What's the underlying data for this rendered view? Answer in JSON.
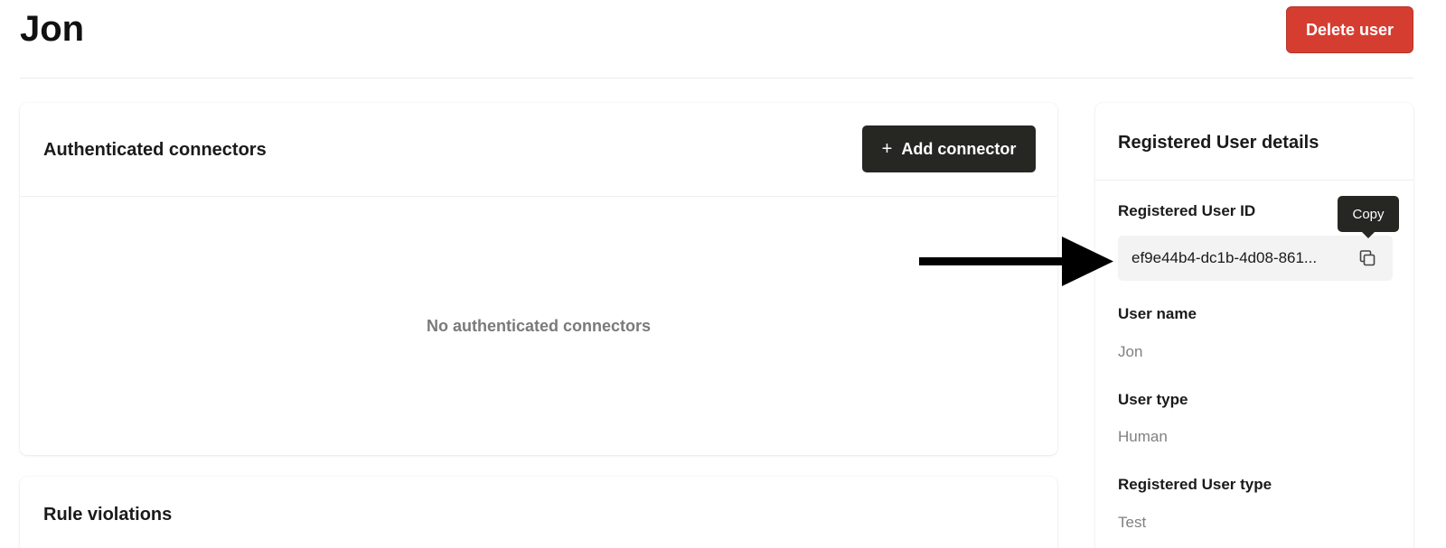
{
  "page": {
    "title": "Jon",
    "delete_button_label": "Delete user"
  },
  "connectors_card": {
    "title": "Authenticated connectors",
    "add_button_label": "Add connector",
    "add_button_icon": "plus-icon",
    "empty_message": "No authenticated connectors"
  },
  "rules_card": {
    "title": "Rule violations"
  },
  "details_card": {
    "title": "Registered User details",
    "fields": [
      {
        "label": "Registered User ID",
        "value": "ef9e44b4-dc1b-4d08-861..."
      },
      {
        "label": "User name",
        "value": "Jon"
      },
      {
        "label": "User type",
        "value": "Human"
      },
      {
        "label": "Registered User type",
        "value": "Test"
      }
    ],
    "copy_icon": "copy-icon",
    "copy_tooltip": "Copy"
  },
  "annotation": {
    "arrow_icon": "arrow-right-icon"
  },
  "colors": {
    "danger": "#d63d31",
    "dark_button": "#262623",
    "muted_text": "#808080",
    "id_box_bg": "#f3f3f3"
  }
}
